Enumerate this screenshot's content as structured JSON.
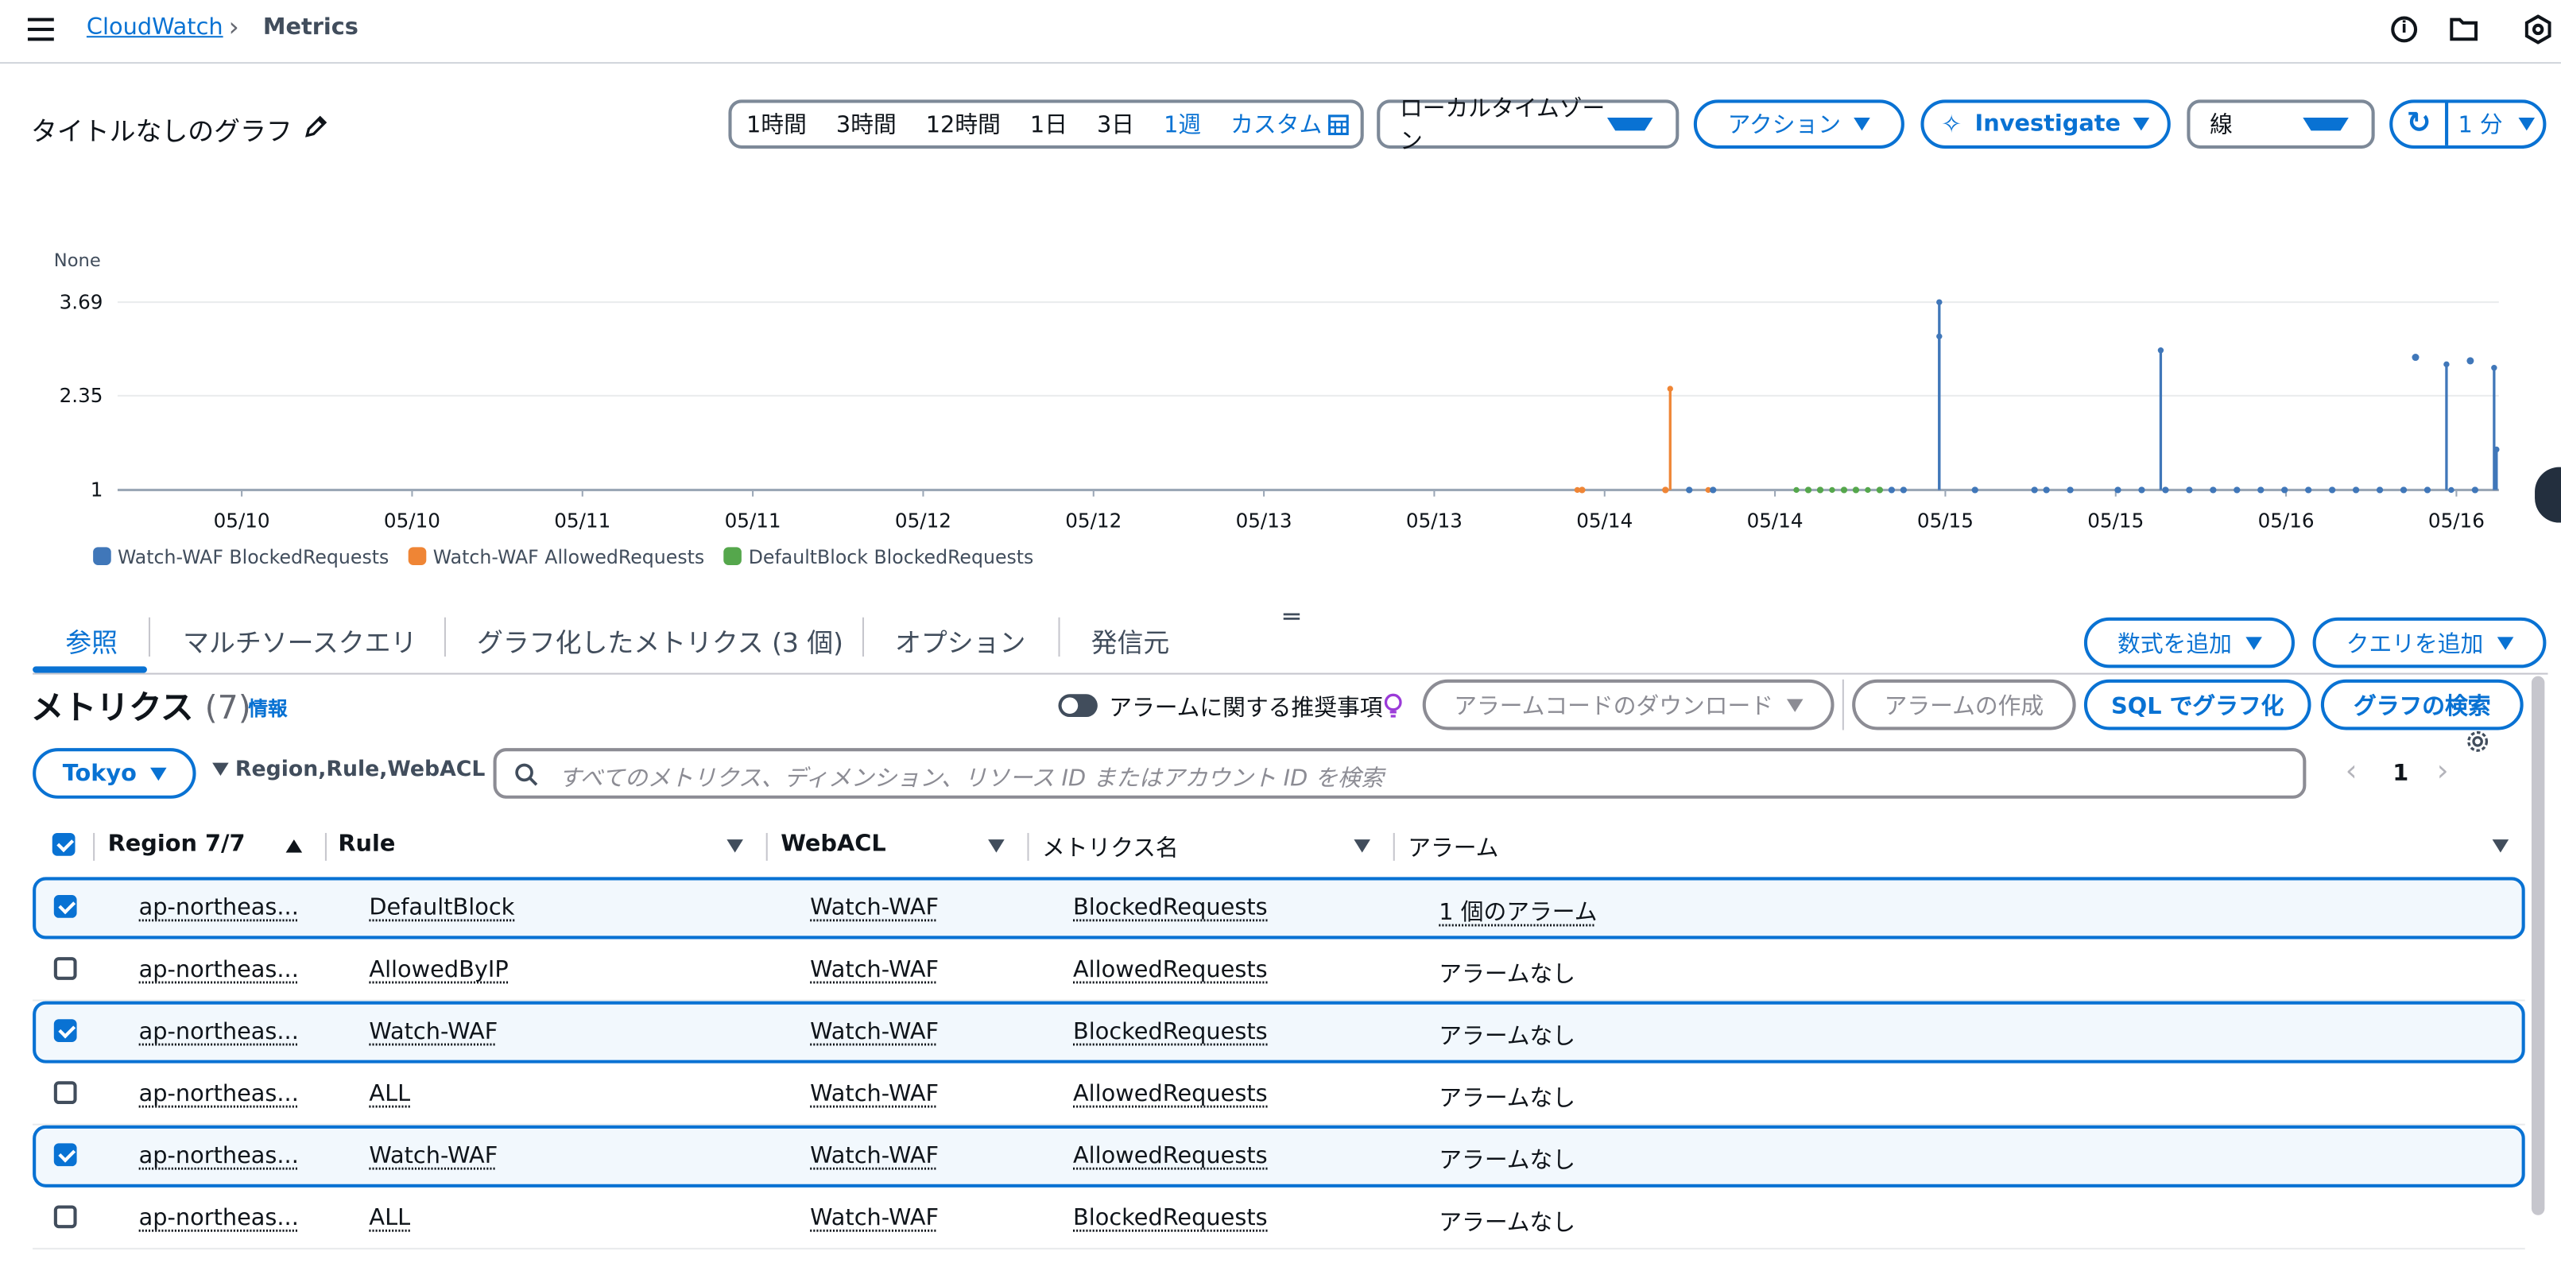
{
  "breadcrumb": {
    "home": "CloudWatch",
    "current": "Metrics"
  },
  "graph": {
    "title": "タイトルなしのグラフ",
    "time_ranges": [
      "1時間",
      "3時間",
      "12時間",
      "1日",
      "3日",
      "1週",
      "カスタム"
    ],
    "active_range": "1週",
    "timezone": "ローカルタイムゾーン",
    "actions": "アクション",
    "investigate": "Investigate",
    "graph_type": "線",
    "period": "1 分"
  },
  "chart_data": {
    "type": "line",
    "y_unit": "None",
    "y_ticks": [
      "3.69",
      "2.35",
      "1"
    ],
    "ylim": [
      1,
      3.69
    ],
    "x_ticks": [
      "05/10",
      "05/10",
      "05/11",
      "05/11",
      "05/12",
      "05/12",
      "05/13",
      "05/13",
      "05/14",
      "05/14",
      "05/15",
      "05/15",
      "05/16",
      "05/16"
    ],
    "grid": true,
    "legend_position": "bottom-left",
    "series": [
      {
        "name": "Watch-WAF BlockedRequests",
        "color": "#4077b9",
        "values": [
          [
            0.765,
            3.69
          ],
          [
            0.765,
            3.2
          ],
          [
            0.858,
            3.0
          ],
          [
            0.978,
            2.8
          ],
          [
            0.998,
            2.75
          ],
          [
            0.98,
            1.0
          ],
          [
            0.999,
            1.58
          ]
        ]
      },
      {
        "name": "Watch-WAF AllowedRequests",
        "color": "#ef8535",
        "values": [
          [
            0.613,
            1.0
          ],
          [
            0.652,
            2.45
          ],
          [
            0.668,
            1.0
          ]
        ]
      },
      {
        "name": "DefaultBlock BlockedRequests",
        "color": "#55a74c",
        "values": [
          [
            0.705,
            1.0
          ],
          [
            0.72,
            1.0
          ],
          [
            0.735,
            1.0
          ]
        ]
      }
    ]
  },
  "tabs": [
    "参照",
    "マルチソースクエリ",
    "グラフ化したメトリクス (3 個)",
    "オプション",
    "発信元"
  ],
  "active_tab": "参照",
  "tab_actions": {
    "add_math": "数式を追加",
    "add_query": "クエリを追加"
  },
  "metrics": {
    "heading": "メトリクス",
    "count": "(7)",
    "info": "情報",
    "alarm_toggle_label": "アラームに関する推奨事項",
    "download_alarm_code": "アラームコードのダウンロード",
    "create_alarm": "アラームの作成",
    "sql_graph": "SQL でグラフ化",
    "search_graph": "グラフの検索",
    "region_filter": "Tokyo",
    "dimension_filter": "Region,Rule,WebACL",
    "search_placeholder": "すべてのメトリクス、ディメンション、リソース ID またはアカウント ID を検索",
    "page": "1",
    "columns": {
      "region": "Region 7/7",
      "rule": "Rule",
      "webacl": "WebACL",
      "metric": "メトリクス名",
      "alarm": "アラーム"
    },
    "rows": [
      {
        "checked": true,
        "region": "ap-northeas...",
        "rule": "DefaultBlock",
        "webacl": "Watch-WAF",
        "metric": "BlockedRequests",
        "alarm": "1 個のアラーム"
      },
      {
        "checked": false,
        "region": "ap-northeas...",
        "rule": "AllowedByIP",
        "webacl": "Watch-WAF",
        "metric": "AllowedRequests",
        "alarm": "アラームなし"
      },
      {
        "checked": true,
        "region": "ap-northeas...",
        "rule": "Watch-WAF",
        "webacl": "Watch-WAF",
        "metric": "BlockedRequests",
        "alarm": "アラームなし"
      },
      {
        "checked": false,
        "region": "ap-northeas...",
        "rule": "ALL",
        "webacl": "Watch-WAF",
        "metric": "AllowedRequests",
        "alarm": "アラームなし"
      },
      {
        "checked": true,
        "region": "ap-northeas...",
        "rule": "Watch-WAF",
        "webacl": "Watch-WAF",
        "metric": "AllowedRequests",
        "alarm": "アラームなし"
      },
      {
        "checked": false,
        "region": "ap-northeas...",
        "rule": "ALL",
        "webacl": "Watch-WAF",
        "metric": "BlockedRequests",
        "alarm": "アラームなし"
      }
    ]
  }
}
